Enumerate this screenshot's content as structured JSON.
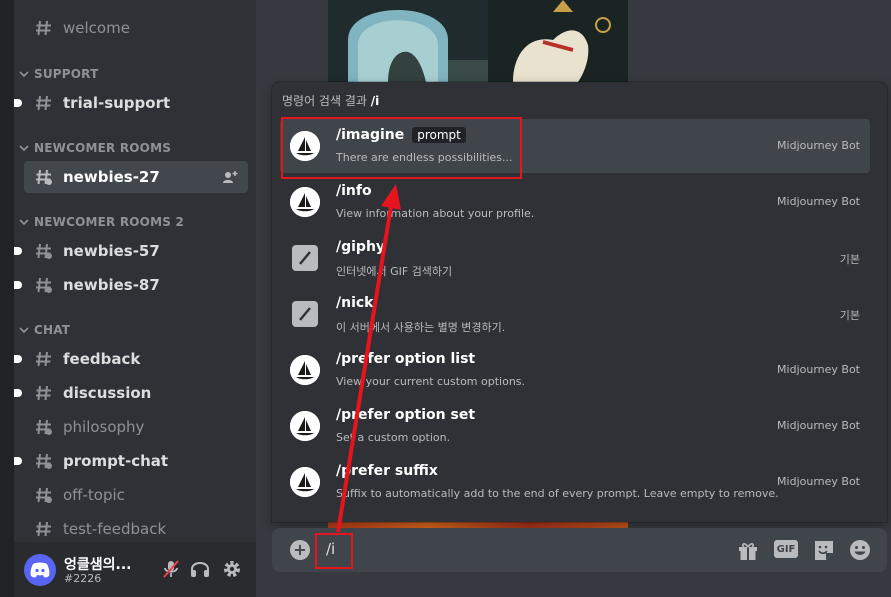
{
  "sidebar": {
    "channels": [
      {
        "name": "welcome",
        "unread": false
      },
      {
        "name": "trial-support",
        "unread": true
      },
      {
        "name": "newbies-27",
        "unread": false
      },
      {
        "name": "newbies-57",
        "unread": true
      },
      {
        "name": "newbies-87",
        "unread": true
      },
      {
        "name": "feedback",
        "unread": true
      },
      {
        "name": "discussion",
        "unread": true
      },
      {
        "name": "philosophy",
        "unread": false
      },
      {
        "name": "prompt-chat",
        "unread": true
      },
      {
        "name": "off-topic",
        "unread": false
      },
      {
        "name": "test-feedback",
        "unread": false
      }
    ],
    "categories": [
      "SUPPORT",
      "NEWCOMER ROOMS",
      "NEWCOMER ROOMS 2",
      "CHAT"
    ]
  },
  "user": {
    "name": "엉클샘의...",
    "tag": "#2226"
  },
  "autocomplete": {
    "header_prefix": "명령어 검색 결과 ",
    "query": "/i",
    "commands": [
      {
        "name": "/imagine",
        "option": "prompt",
        "description": "There are endless possibilities...",
        "source": "Midjourney Bot",
        "icon": "midjourney-boat-icon"
      },
      {
        "name": "/info",
        "description": "View information about your profile.",
        "source": "Midjourney Bot",
        "icon": "midjourney-boat-icon"
      },
      {
        "name": "/giphy",
        "description": "인터넷에서 GIF 검색하기",
        "source": "기본",
        "icon": "slash-command-icon"
      },
      {
        "name": "/nick",
        "description": "이 서버에서 사용하는 별명 변경하기.",
        "source": "기본",
        "icon": "slash-command-icon"
      },
      {
        "name": "/prefer option list",
        "description": "View your current custom options.",
        "source": "Midjourney Bot",
        "icon": "midjourney-boat-icon"
      },
      {
        "name": "/prefer option set",
        "description": "Set a custom option.",
        "source": "Midjourney Bot",
        "icon": "midjourney-boat-icon"
      },
      {
        "name": "/prefer suffix",
        "description": "Suffix to automatically add to the end of every prompt. Leave empty to remove.",
        "source": "Midjourney Bot",
        "icon": "midjourney-boat-icon"
      }
    ]
  },
  "input": {
    "value": "/i",
    "gif_label": "GIF"
  },
  "colors": {
    "annotation": "#e6141e",
    "blurple": "#5865f2"
  }
}
